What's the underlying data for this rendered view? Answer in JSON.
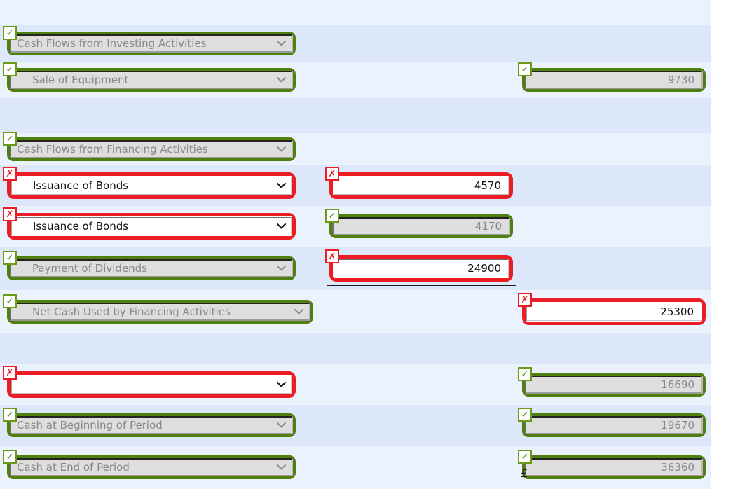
{
  "document": {
    "kind": "statement-of-cash-flows-worksheet",
    "currency_symbol": "£"
  },
  "icons": {
    "check": "✓",
    "cross": "✗",
    "chevron_down": "chevron-down-icon"
  },
  "colors": {
    "correct_border": "#4f7f0d",
    "incorrect_border": "#ec1c24",
    "row_light": "#eaf2fd",
    "row_dark": "#dce8fa",
    "disabled_field": "#dedede",
    "disabled_text": "#888888"
  },
  "rows": [
    {
      "id": "row-spacer-top",
      "account": null,
      "amount": null
    },
    {
      "id": "row-investing-header",
      "account": {
        "value": "Cash Flows from Investing Activities",
        "status": "correct",
        "disabled": true,
        "indent": false
      },
      "amount": null
    },
    {
      "id": "row-sale-of-equipment",
      "account": {
        "value": "Sale of Equipment",
        "status": "correct",
        "disabled": true,
        "indent": true
      },
      "amount": {
        "value": "9730",
        "status": "correct",
        "disabled": true,
        "column": "right"
      }
    },
    {
      "id": "row-spacer-mid",
      "account": null,
      "amount": null
    },
    {
      "id": "row-financing-header",
      "account": {
        "value": "Cash Flows from Financing Activities",
        "status": "correct",
        "disabled": true,
        "indent": false
      },
      "amount": null
    },
    {
      "id": "row-issuance-of-bonds-1",
      "account": {
        "value": "Issuance of Bonds",
        "status": "incorrect",
        "disabled": false,
        "indent": true
      },
      "amount": {
        "value": "4570",
        "status": "incorrect",
        "disabled": false,
        "column": "left"
      }
    },
    {
      "id": "row-issuance-of-bonds-2",
      "account": {
        "value": "Issuance of Bonds",
        "status": "incorrect",
        "disabled": false,
        "indent": true
      },
      "amount": {
        "value": "4170",
        "status": "correct",
        "disabled": true,
        "column": "left"
      }
    },
    {
      "id": "row-payment-of-dividends",
      "account": {
        "value": "Payment of Dividends",
        "status": "correct",
        "disabled": true,
        "indent": true
      },
      "amount": {
        "value": "24900",
        "status": "incorrect",
        "disabled": false,
        "column": "left",
        "rule": "single"
      }
    },
    {
      "id": "row-net-cash-financing",
      "account": {
        "value": "Net Cash Used by Financing Activities",
        "status": "correct",
        "disabled": true,
        "indent": true,
        "wide": true
      },
      "amount": {
        "value": "25300",
        "status": "incorrect",
        "disabled": false,
        "column": "right",
        "rule": "single"
      }
    },
    {
      "id": "row-spacer-bottom",
      "account": null,
      "amount": null
    },
    {
      "id": "row-net-change-in-cash",
      "account": {
        "value": "",
        "status": "incorrect",
        "disabled": false,
        "indent": false
      },
      "amount": {
        "value": "16690",
        "status": "correct",
        "disabled": true,
        "column": "right"
      }
    },
    {
      "id": "row-cash-beginning",
      "account": {
        "value": "Cash at Beginning of Period",
        "status": "correct",
        "disabled": true,
        "indent": false
      },
      "amount": {
        "value": "19670",
        "status": "correct",
        "disabled": true,
        "column": "right",
        "rule": "single"
      }
    },
    {
      "id": "row-cash-end",
      "account": {
        "value": "Cash at End of Period",
        "status": "correct",
        "disabled": true,
        "indent": false
      },
      "amount": {
        "value": "36360",
        "status": "correct",
        "disabled": true,
        "column": "right",
        "rule": "double",
        "currency": "£"
      }
    }
  ]
}
